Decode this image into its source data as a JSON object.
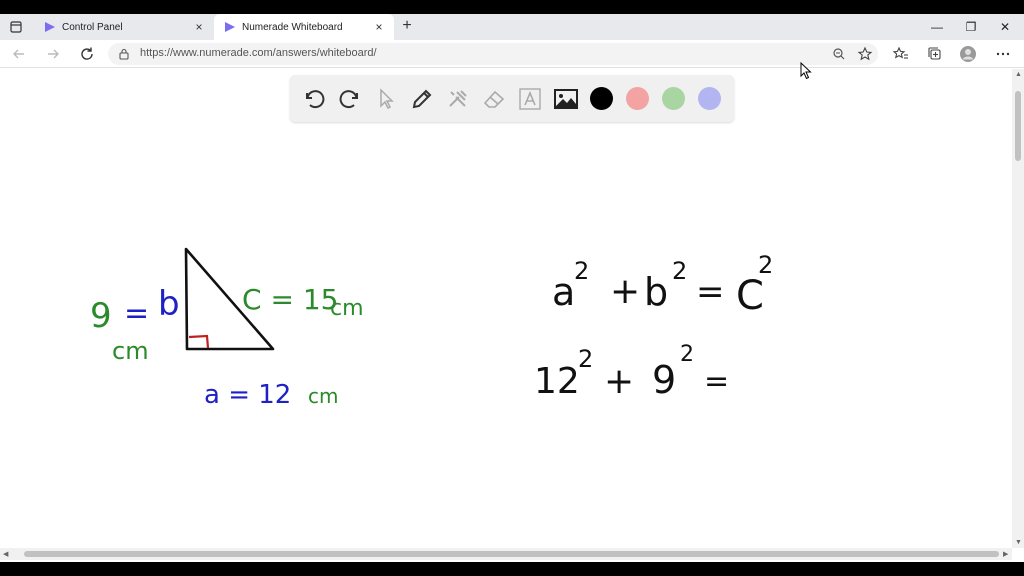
{
  "tabs": [
    {
      "label": "Control Panel",
      "close": "×"
    },
    {
      "label": "Numerade Whiteboard",
      "close": "×"
    }
  ],
  "new_tab": "+",
  "window": {
    "minimize": "—",
    "restore": "❐",
    "close": "✕"
  },
  "address": {
    "url": "https://www.numerade.com/answers/whiteboard/"
  },
  "whiteboard": {
    "colors": {
      "black": "#000000",
      "red": "#f4a3a3",
      "green": "#a8d5a2",
      "blue": "#b3b5f0"
    },
    "labels": {
      "side_b_num": "9",
      "side_b_eq": "=",
      "side_b_var": "b",
      "side_b_unit": "cm",
      "side_c": "C = 15",
      "side_c_unit": "cm",
      "side_a": "a = 12",
      "side_a_unit": "cm"
    },
    "equation1": {
      "a": "a",
      "exp1": "2",
      "plus": "+",
      "b": "b",
      "exp2": "2",
      "eq": "=",
      "c": "C",
      "exp3": "2"
    },
    "equation2": {
      "n1": "12",
      "exp1": "2",
      "plus": "+",
      "n2": "9",
      "exp2": "2",
      "eq": "="
    }
  }
}
